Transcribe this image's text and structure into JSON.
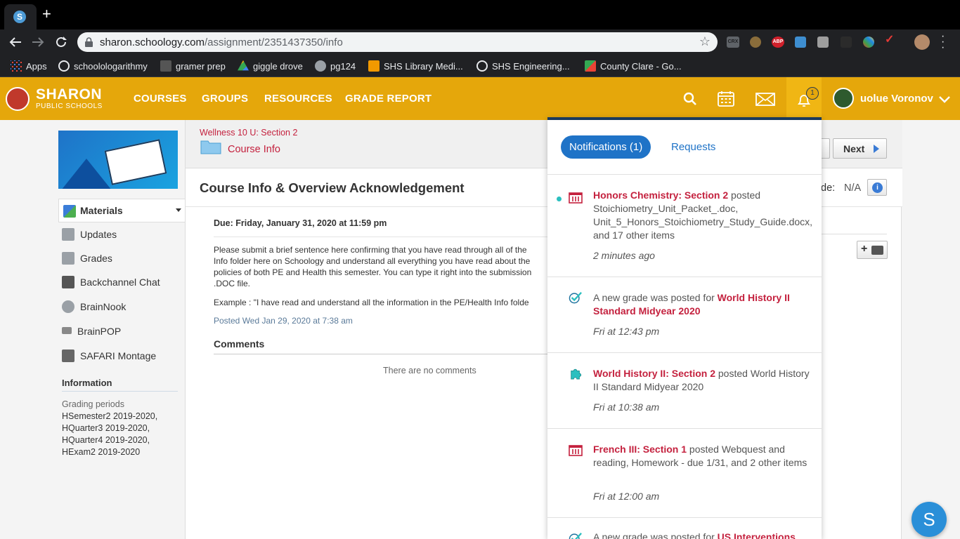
{
  "browser": {
    "new_tab_symbol": "+",
    "url_host": "sharon.schoology.com",
    "url_path": "/assignment/2351437350/info",
    "bookmarks": [
      {
        "label": "Apps",
        "icon": "apps-grid-icon"
      },
      {
        "label": "schoolologarithmy",
        "icon": "schoology-icon"
      },
      {
        "label": "gramer prep",
        "icon": "gb-icon"
      },
      {
        "label": "giggle drove",
        "icon": "drive-icon"
      },
      {
        "label": "pg124",
        "icon": "globe-icon"
      },
      {
        "label": "SHS Library Medi...",
        "icon": "library-icon"
      },
      {
        "label": "SHS Engineering...",
        "icon": "schoology-icon"
      },
      {
        "label": "County Clare - Go...",
        "icon": "maps-icon"
      }
    ],
    "extensions": [
      {
        "label": "CRX"
      },
      {
        "label": "ABP"
      }
    ]
  },
  "site": {
    "logo_title": "SHARON",
    "logo_subtitle": "PUBLIC SCHOOLS",
    "nav": [
      "COURSES",
      "GROUPS",
      "RESOURCES",
      "GRADE REPORT"
    ],
    "notification_count": "1",
    "user_name": "uolue Voronov",
    "accent": "#e5a70b"
  },
  "sidebar": {
    "items": [
      {
        "label": "Materials"
      },
      {
        "label": "Updates"
      },
      {
        "label": "Grades"
      },
      {
        "label": "Backchannel Chat"
      },
      {
        "label": "BrainNook"
      },
      {
        "label": "BrainPOP"
      },
      {
        "label": "SAFARI Montage"
      }
    ],
    "info_heading": "Information",
    "grading_label": "Grading periods",
    "grading_periods": [
      "HSemester2 2019-2020,",
      "HQuarter3 2019-2020,",
      "HQuarter4 2019-2020,",
      "HExam2 2019-2020"
    ]
  },
  "main": {
    "course_link": "Wellness 10 U: Section 2",
    "folder_link": "Course Info",
    "next_label": "Next",
    "title": "Course Info & Overview Acknowledgement",
    "grade_label": "de:",
    "grade_value": "N/A",
    "due": "Due: Friday, January 31, 2020 at 11:59 pm",
    "body_lines": [
      "Please submit a brief sentence here confirming that you have read through all of the",
      "Info folder here on Schoology and understand all everything you have read about the",
      "policies of both PE and Health this semester. You can type it right into the submission",
      ".DOC file."
    ],
    "example": "Example : \"I have read and understand all the information in the PE/Health Info folde",
    "posted": "Posted Wed Jan 29, 2020 at 7:38 am",
    "comments_heading": "Comments",
    "no_comments": "There are no comments"
  },
  "notifications": {
    "tab_active": "Notifications (1)",
    "tab_other": "Requests",
    "items": [
      {
        "link": "Honors Chemistry: Section 2",
        "text": " posted Stoichiometry_Unit_Packet_.doc, Unit_5_Honors_Stoichiometry_Study_Guide.docx, and 17 other items",
        "time": "2 minutes ago",
        "icon": "course-materials-icon"
      },
      {
        "pre": "A new grade was posted for ",
        "link": "World History II Standard Midyear 2020",
        "text": "",
        "time": "Fri at 12:43 pm",
        "icon": "grade-check-icon"
      },
      {
        "link": "World History II: Section 2",
        "text": " posted World History II Standard Midyear 2020",
        "time": "Fri at 10:38 am",
        "icon": "puzzle-icon"
      },
      {
        "link": "French III: Section 1",
        "text": " posted Webquest and reading, Homework - due 1/31, and 2 other items",
        "time": "Fri at 12:00 am",
        "icon": "course-materials-icon"
      },
      {
        "pre": "A new grade was posted for ",
        "link": "US Interventions",
        "text": "",
        "time": "",
        "icon": "grade-check-icon"
      }
    ]
  },
  "chat_button": "S"
}
